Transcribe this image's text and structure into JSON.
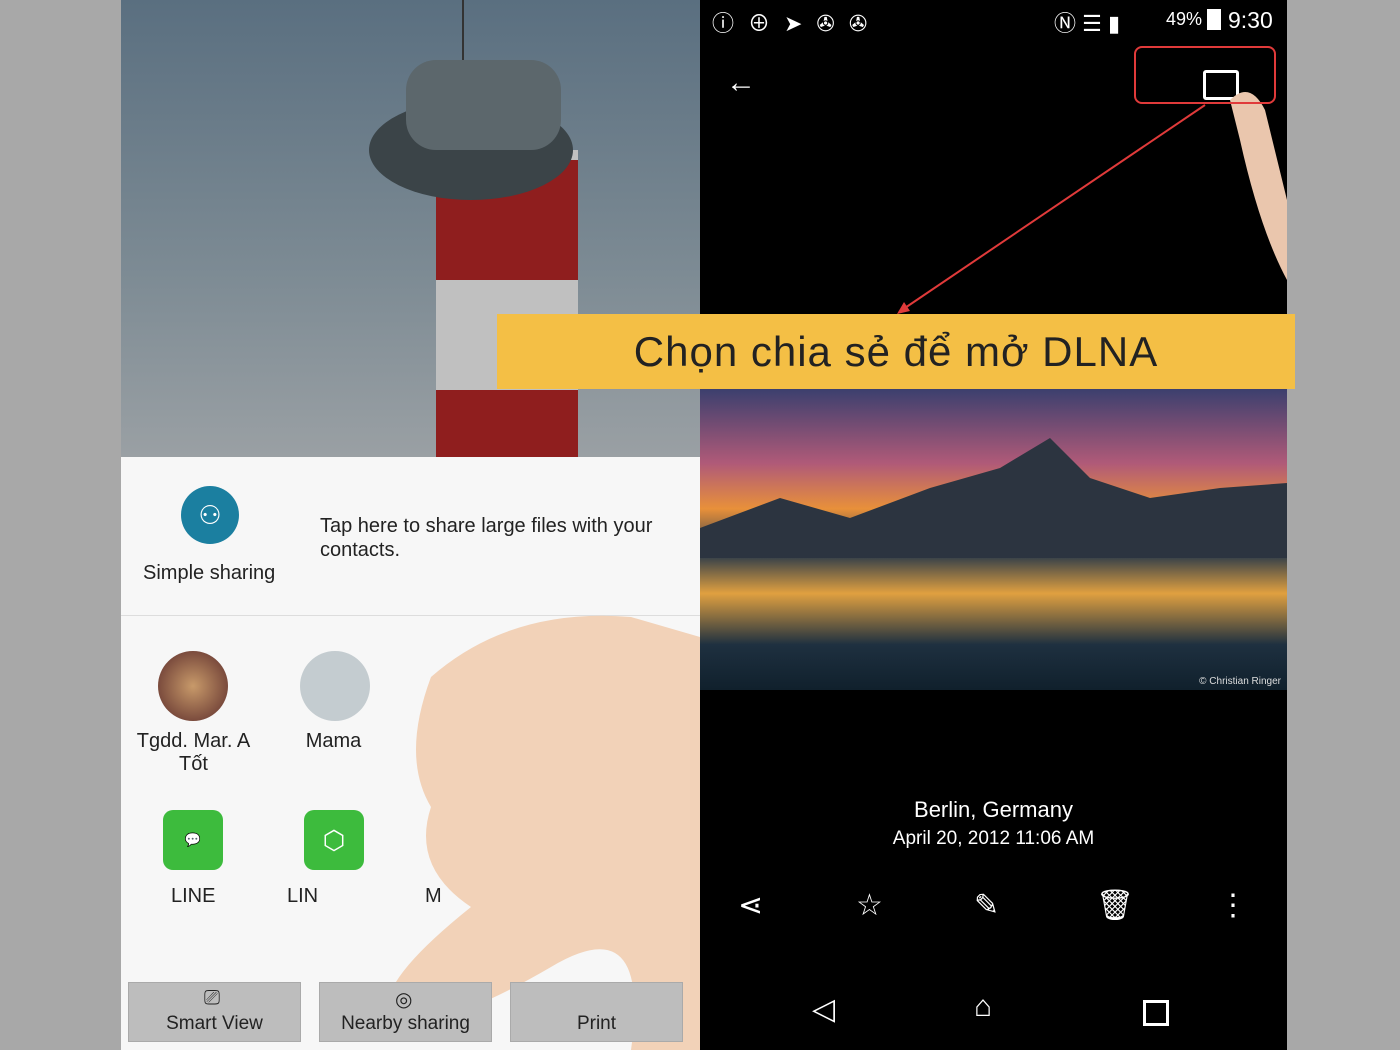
{
  "banner": {
    "text": "Chọn chia sẻ để mở DLNA",
    "color": "#f4bf45"
  },
  "highlight_color": "#e03a3a",
  "share_sheet": {
    "simple_sharing": {
      "label": "Simple sharing",
      "description": "Tap here to share large files with your contacts."
    },
    "contacts": [
      {
        "name": "Tgdd. Mar. A Tốt"
      },
      {
        "name": "Mama"
      }
    ],
    "apps": [
      {
        "label": "LINE"
      },
      {
        "label": "LIN"
      },
      {
        "label": "M"
      }
    ],
    "bottom_buttons": [
      {
        "label": "Smart View"
      },
      {
        "label": "Nearby sharing"
      },
      {
        "label": "Print"
      }
    ]
  },
  "status_bar": {
    "battery": "49%",
    "time": "9:30"
  },
  "photo": {
    "location": "Berlin, Germany",
    "datetime": "April 20, 2012 11:06 AM",
    "credit": "© Christian Ringer"
  },
  "actions": [
    "share-icon",
    "star-icon",
    "edit-icon",
    "delete-icon",
    "more-icon"
  ],
  "nav": [
    "back-icon",
    "home-icon",
    "recents-icon"
  ]
}
